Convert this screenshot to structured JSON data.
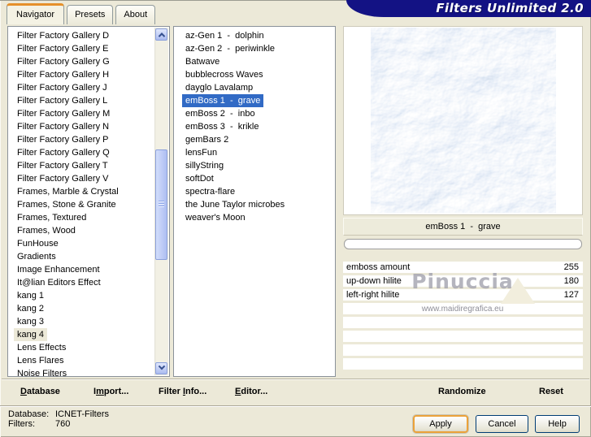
{
  "window": {
    "title": "Filters Unlimited 2.0"
  },
  "tabs": [
    {
      "label": "Navigator",
      "active": true
    },
    {
      "label": "Presets",
      "active": false
    },
    {
      "label": "About",
      "active": false
    }
  ],
  "categories": {
    "items": [
      "Filter Factory Gallery D",
      "Filter Factory Gallery E",
      "Filter Factory Gallery G",
      "Filter Factory Gallery H",
      "Filter Factory Gallery J",
      "Filter Factory Gallery L",
      "Filter Factory Gallery M",
      "Filter Factory Gallery N",
      "Filter Factory Gallery P",
      "Filter Factory Gallery Q",
      "Filter Factory Gallery T",
      "Filter Factory Gallery V",
      "Frames, Marble & Crystal",
      "Frames, Stone & Granite",
      "Frames, Textured",
      "Frames, Wood",
      "FunHouse",
      "Gradients",
      "Image Enhancement",
      "It@lian Editors Effect",
      "kang 1",
      "kang 2",
      "kang 3",
      {
        "label": "kang 4",
        "selected": true
      },
      "Lens Effects",
      "Lens Flares",
      "Noise Filters"
    ]
  },
  "filters_list": {
    "items": [
      "az-Gen 1  -  dolphin",
      "az-Gen 2  -  periwinkle",
      "Batwave",
      "bubblecross Waves",
      "dayglo Lavalamp",
      {
        "label": "emBoss 1  -  grave",
        "selected": true
      },
      "emBoss 2  -  inbo",
      "emBoss 3  -  krikle",
      "gemBars 2",
      "lensFun",
      "sillyString",
      "softDot",
      "spectra-flare",
      "the June Taylor microbes",
      "weaver's Moon"
    ]
  },
  "preview": {
    "caption": "emBoss 1  -  grave"
  },
  "params": {
    "rows": [
      {
        "label": "emboss amount",
        "value": "255"
      },
      {
        "label": "up-down hilite",
        "value": "180"
      },
      {
        "label": "left-right hilite",
        "value": "127"
      }
    ]
  },
  "watermark": {
    "name": "Pinuccia",
    "url": "www.maidiregrafica.eu"
  },
  "toolbar": {
    "database": {
      "pre": "",
      "key": "D",
      "post": "atabase"
    },
    "import": {
      "pre": "I",
      "key": "m",
      "post": "port..."
    },
    "filter_info": {
      "pre": "Filter ",
      "key": "I",
      "post": "nfo..."
    },
    "editor": {
      "pre": "",
      "key": "E",
      "post": "ditor..."
    },
    "randomize": "Randomize",
    "reset": "Reset"
  },
  "status": {
    "database_label": "Database:",
    "database_value": "ICNET-Filters",
    "filters_label": "Filters:",
    "filters_value": "760"
  },
  "actions": {
    "apply": "Apply",
    "cancel": "Cancel",
    "help": "Help"
  },
  "colors": {
    "dialog": "#ece9d8",
    "selection": "#316ac5",
    "banner": "#131284",
    "tab_accent": "#e6902a"
  }
}
